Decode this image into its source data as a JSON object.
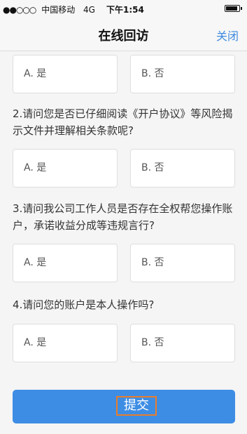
{
  "status_bar": {
    "signal": "●●○○○",
    "carrier": "中国移动",
    "network": "4G",
    "time": "下午1:54"
  },
  "nav": {
    "title": "在线回访",
    "close_label": "关闭"
  },
  "questions": [
    {
      "text": "",
      "options": [
        "A. 是",
        "B. 否"
      ]
    },
    {
      "text": "2.请问您是否已仔细阅读《开户协议》等风险揭示文件并理解相关条款呢?",
      "options": [
        "A. 是",
        "B. 否"
      ]
    },
    {
      "text": "3.请问我公司工作人员是否存在全权帮您操作账户，承诺收益分成等违规言行?",
      "options": [
        "A. 是",
        "B. 否"
      ]
    },
    {
      "text": "4.请问您的账户是本人操作吗?",
      "options": [
        "A. 是",
        "B. 否"
      ]
    }
  ],
  "submit_label": "提交"
}
